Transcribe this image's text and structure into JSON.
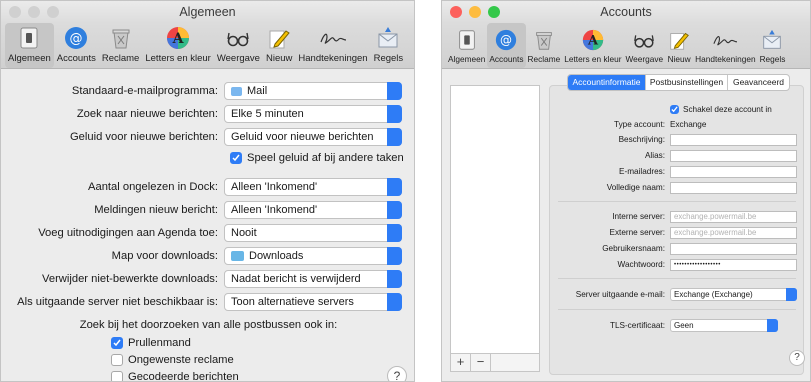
{
  "general_window": {
    "title": "Algemeen",
    "toolbar": [
      {
        "label": "Algemeen",
        "icon": "switch-icon",
        "selected": true
      },
      {
        "label": "Accounts",
        "icon": "at-sign-icon",
        "selected": false
      },
      {
        "label": "Reclame",
        "icon": "trash-icon",
        "selected": false
      },
      {
        "label": "Letters en kleur",
        "icon": "font-color-icon",
        "selected": false
      },
      {
        "label": "Weergave",
        "icon": "glasses-icon",
        "selected": false
      },
      {
        "label": "Nieuw",
        "icon": "pencil-icon",
        "selected": false
      },
      {
        "label": "Handtekeningen",
        "icon": "signature-icon",
        "selected": false
      },
      {
        "label": "Regels",
        "icon": "rules-envelope-icon",
        "selected": false
      }
    ],
    "settings": [
      {
        "label": "Standaard-e-mailprogramma:",
        "value": "Mail"
      },
      {
        "label": "Zoek naar nieuwe berichten:",
        "value": "Elke 5 minuten"
      },
      {
        "label": "Geluid voor nieuwe berichten:",
        "value": "Geluid voor nieuwe berichten"
      },
      {
        "label": "Aantal ongelezen in Dock:",
        "value": "Alleen 'Inkomend'"
      },
      {
        "label": "Meldingen nieuw bericht:",
        "value": "Alleen 'Inkomend'"
      },
      {
        "label": "Voeg uitnodigingen aan Agenda toe:",
        "value": "Nooit"
      },
      {
        "label": "Map voor downloads:",
        "value": "Downloads"
      },
      {
        "label": "Verwijder niet-bewerkte downloads:",
        "value": "Nadat bericht is verwijderd"
      },
      {
        "label": "Als uitgaande server niet beschikbaar is:",
        "value": "Toon alternatieve servers"
      }
    ],
    "play_sound_checkbox": {
      "label": "Speel geluid af bij andere taken",
      "checked": true
    },
    "search_heading": "Zoek bij het doorzoeken van alle postbussen ook in:",
    "search_options": [
      {
        "label": "Prullenmand",
        "checked": true
      },
      {
        "label": "Ongewenste reclame",
        "checked": false
      },
      {
        "label": "Gecodeerde berichten",
        "checked": false
      }
    ],
    "help": "?"
  },
  "accounts_window": {
    "title": "Accounts",
    "toolbar": [
      {
        "label": "Algemeen",
        "icon": "switch-icon",
        "selected": false
      },
      {
        "label": "Accounts",
        "icon": "at-sign-icon",
        "selected": true
      },
      {
        "label": "Reclame",
        "icon": "trash-icon",
        "selected": false
      },
      {
        "label": "Letters en kleur",
        "icon": "font-color-icon",
        "selected": false
      },
      {
        "label": "Weergave",
        "icon": "glasses-icon",
        "selected": false
      },
      {
        "label": "Nieuw",
        "icon": "pencil-icon",
        "selected": false
      },
      {
        "label": "Handtekeningen",
        "icon": "signature-icon",
        "selected": false
      },
      {
        "label": "Regels",
        "icon": "rules-envelope-icon",
        "selected": false
      }
    ],
    "tabs": [
      {
        "label": "Accountinformatie",
        "active": true
      },
      {
        "label": "Postbusinstellingen",
        "active": false
      },
      {
        "label": "Geavanceerd",
        "active": false
      }
    ],
    "enable_checkbox": {
      "label": "Schakel deze account in",
      "checked": true
    },
    "account_type": {
      "label": "Type account:",
      "value": "Exchange"
    },
    "fields_top": [
      {
        "label": "Beschrijving:",
        "value": ""
      },
      {
        "label": "Alias:",
        "value": ""
      },
      {
        "label": "E-mailadres:",
        "value": ""
      },
      {
        "label": "Volledige naam:",
        "value": ""
      }
    ],
    "fields_server": [
      {
        "label": "Interne server:",
        "placeholder": "exchange.powermail.be"
      },
      {
        "label": "Externe server:",
        "placeholder": "exchange.powermail.be"
      },
      {
        "label": "Gebruikersnaam:",
        "value": ""
      },
      {
        "label": "Wachtwoord:",
        "value": "••••••••••••••••••"
      }
    ],
    "outgoing_server": {
      "label": "Server uitgaande e-mail:",
      "value": "Exchange (Exchange)"
    },
    "tls": {
      "label": "TLS-certificaat:",
      "value": "Geen"
    },
    "add_button": "+",
    "remove_button": "−",
    "help": "?"
  },
  "colors": {
    "accent": "#2e7cf6",
    "close": "#fc605c",
    "minimize": "#fdbc40",
    "zoom": "#34c84a"
  }
}
